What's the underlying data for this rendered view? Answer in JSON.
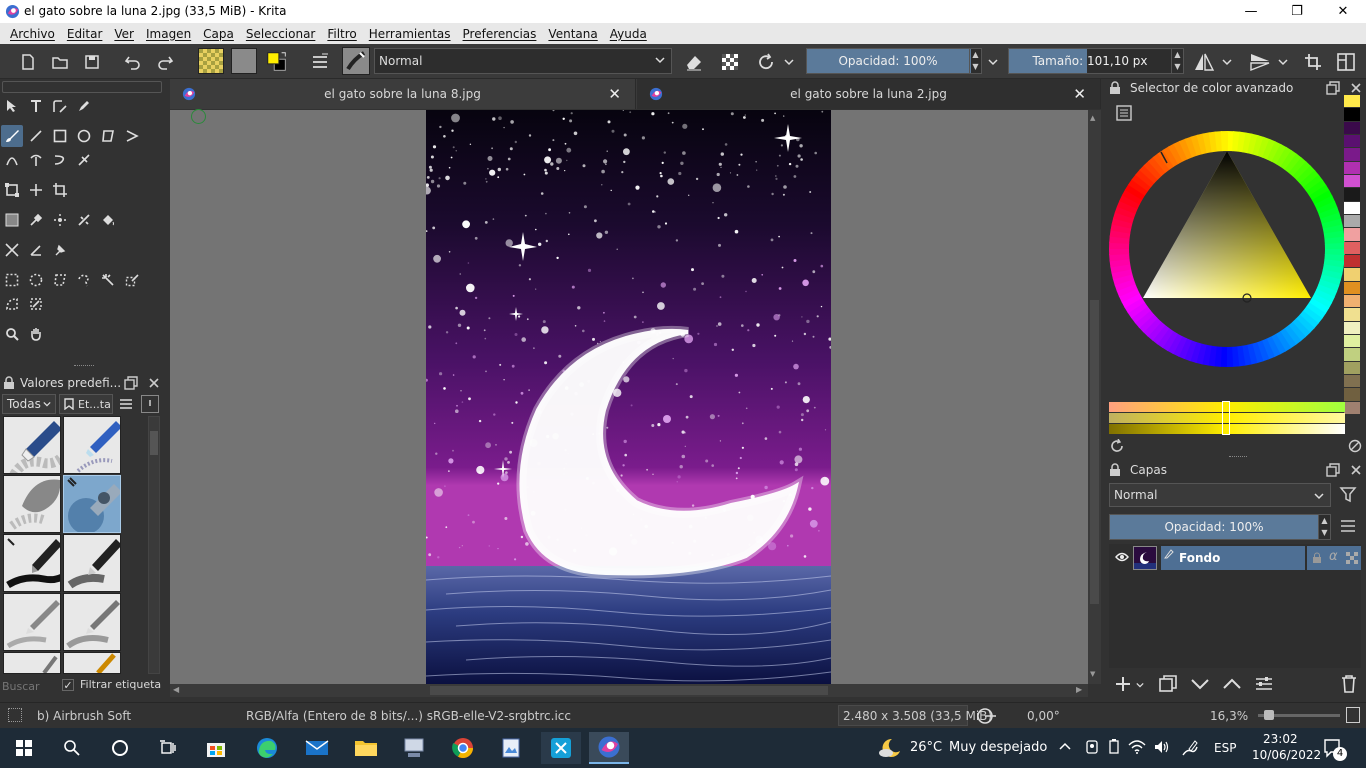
{
  "window": {
    "title": "el gato sobre la luna 2.jpg (33,5 MiB)  - Krita",
    "minimize": "—",
    "maximize": "❐",
    "close": "✕"
  },
  "menu": [
    "Archivo",
    "Editar",
    "Ver",
    "Imagen",
    "Capa",
    "Seleccionar",
    "Filtro",
    "Herramientas",
    "Preferencias",
    "Ventana",
    "Ayuda"
  ],
  "toolbar": {
    "blend_mode": "Normal",
    "opacity": "Opacidad: 100%",
    "size": "Tamaño: 101,10 px",
    "opacity_fraction": 1.0
  },
  "presets": {
    "title": "Valores predefi...",
    "filter_all": "Todas",
    "tag_label": "Et...ta",
    "search_placeholder": "Buscar",
    "filter_tag_label": "Filtrar etiqueta",
    "filter_tag_checked": "✓"
  },
  "tabs": [
    {
      "label": "el gato sobre la luna 8.jpg",
      "close": "✕"
    },
    {
      "label": "el gato sobre la luna 2.jpg",
      "close": "✕"
    }
  ],
  "color_selector": {
    "title": "Selector de color avanzado",
    "accent": "#ffee00"
  },
  "layers": {
    "title": "Capas",
    "blend_mode": "Normal",
    "opacity": "Opacidad:  100%",
    "layer_name": "Fondo"
  },
  "status": {
    "brush": "b) Airbrush Soft",
    "color_model": "RGB/Alfa (Entero de 8 bits/...)  sRGB-elle-V2-srgbtrc.icc",
    "dimensions": "2.480 x 3.508 (33,5 MiB)",
    "rotation": "0,00°",
    "zoom": "16,3%"
  },
  "taskbar": {
    "weather_temp": "26°C",
    "weather_text": "Muy despejado",
    "lang": "ESP",
    "time": "23:02",
    "date": "10/06/2022",
    "notifications": "4"
  },
  "palette": [
    "#ffe94a",
    "#000000",
    "#3a0a4a",
    "#5a1070",
    "#7a1a8a",
    "#b030b0",
    "#d050d0",
    "#1a1a1a",
    "#ffffff",
    "#aaaaaa",
    "#f0a0a0",
    "#e06060",
    "#c03030",
    "#f0d070",
    "#e09020",
    "#f0b070",
    "#f0e090",
    "#f0f0c0",
    "#e0f0a0",
    "#c0d080",
    "#a0a060",
    "#807050",
    "#706040",
    "#a08070"
  ]
}
